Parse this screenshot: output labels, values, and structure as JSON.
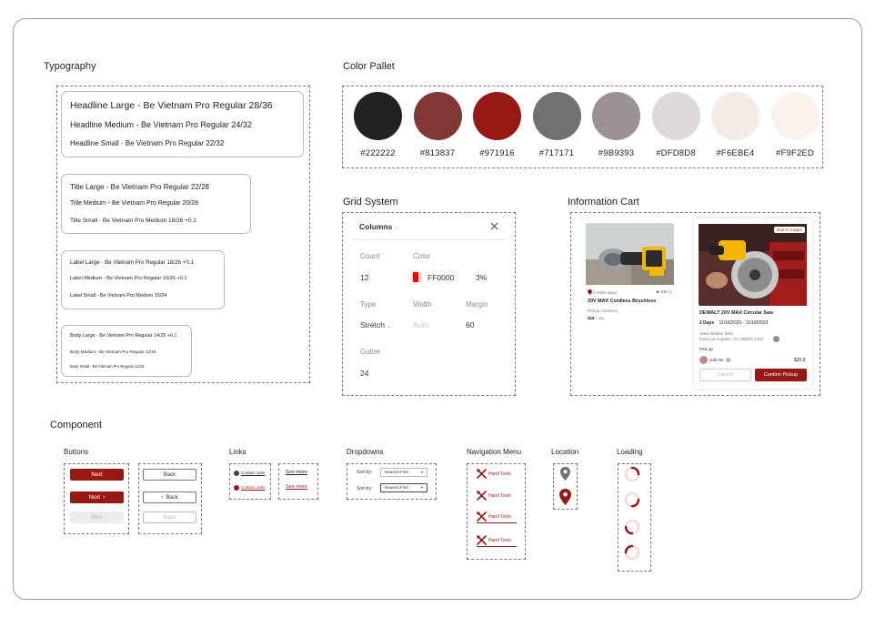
{
  "sections": {
    "typography": "Typography",
    "color": "Color Pallet",
    "grid": "Grid System",
    "info": "Information Cart",
    "component": "Component"
  },
  "typography": {
    "headline": [
      "Headline Large - Be Vietnam Pro Regular 28/36",
      "Headline Medium - Be Vietnam Pro Regular 24/32",
      "Headline Small - Be Vietnam Pro Regular 22/32"
    ],
    "title": [
      "Title Large - Be Vietnam Pro Regular 22/28",
      "Title Medium - Be Vietnam Pro Regular 20/28",
      "Title Small - Be Vietnam Pro Medium 18/26 +0.1"
    ],
    "label": [
      "Label Large - Be Vietnam Pro Regular 18/26 +0.1",
      "Label Medium - Be Vietnam Pro Regular 16/26 +0.1",
      "Label Small -  Be Vietnam Pro Medium 15/24"
    ],
    "body": [
      "Body Large - Be Vietnam Pro Regular 14/25 +0.1",
      "Body Medium - Be Vietnam Pro Regular 12/16",
      "Body Small - Be Vietnam Pro Regular 11/16"
    ]
  },
  "palette": [
    {
      "hex": "#222222",
      "color": "#222222"
    },
    {
      "hex": "#813837",
      "color": "#813837"
    },
    {
      "hex": "#971916",
      "color": "#971916"
    },
    {
      "hex": "#717171",
      "color": "#717171"
    },
    {
      "hex": "#9B9393",
      "color": "#9B9393"
    },
    {
      "hex": "#DFD8D8",
      "color": "#DFD8D8"
    },
    {
      "hex": "#F6EBE4",
      "color": "#F6EBE4"
    },
    {
      "hex": "#F9F2ED",
      "color": "#F9F2ED"
    }
  ],
  "grid": {
    "header": "Columns",
    "count_label": "Count",
    "count_value": "12",
    "color_label": "Color",
    "color_value": "FF0000",
    "opacity": "3%",
    "type_label": "Type",
    "type_value": "Stretch",
    "width_label": "Width",
    "width_value": "Auto",
    "margin_label": "Margin",
    "margin_value": "60",
    "gutter_label": "Gutter",
    "gutter_value": "24"
  },
  "cart": {
    "left": {
      "distance": "2 miles away",
      "rating": "4.8",
      "rating_count": "(1)",
      "name": "20V MAX Cordless Brushless",
      "mode": "Pickup / Delivery",
      "price": "$15",
      "per": "/ day"
    },
    "right": {
      "badge": "Due in 2 days",
      "name": "DEWALT 20V MAX Circular Saw",
      "days": "2 Days",
      "dates": "11/16/2023 - 11/18/2023",
      "address1": "4565 Whittier Blvd",
      "address2": "East Los Angeles, CA, 90022-2422",
      "pickup": "Pick up",
      "user": "John M.",
      "price": "$30.8",
      "cancel": "Cancel",
      "confirm": "Confirm Pickup"
    }
  },
  "components": {
    "buttons_title": "Buttons",
    "links_title": "Links",
    "dropdowns_title": "Dropdowns",
    "nav_title": "Navigation Menu",
    "location_title": "Location",
    "loading_title": "Loading",
    "buttons": {
      "next": "Next",
      "next2": "Next",
      "next_disabled": "Next",
      "back": "Back",
      "back2": "Back",
      "back_disabled": "Back"
    },
    "links": {
      "contact1": "Contact John",
      "contact2": "Contact John",
      "see1": "See more",
      "see2": "See more"
    },
    "dropdowns": {
      "label1": "Sort by:",
      "value1": "Nearest First",
      "label2": "Sort by:",
      "value2": "Nearest First"
    },
    "nav": [
      "Hand Tools",
      "Hand Tools",
      "Hand Tools",
      "Hand Tools"
    ]
  },
  "colors": {
    "accent": "#971916",
    "dark": "#222222",
    "grey": "#717171"
  }
}
